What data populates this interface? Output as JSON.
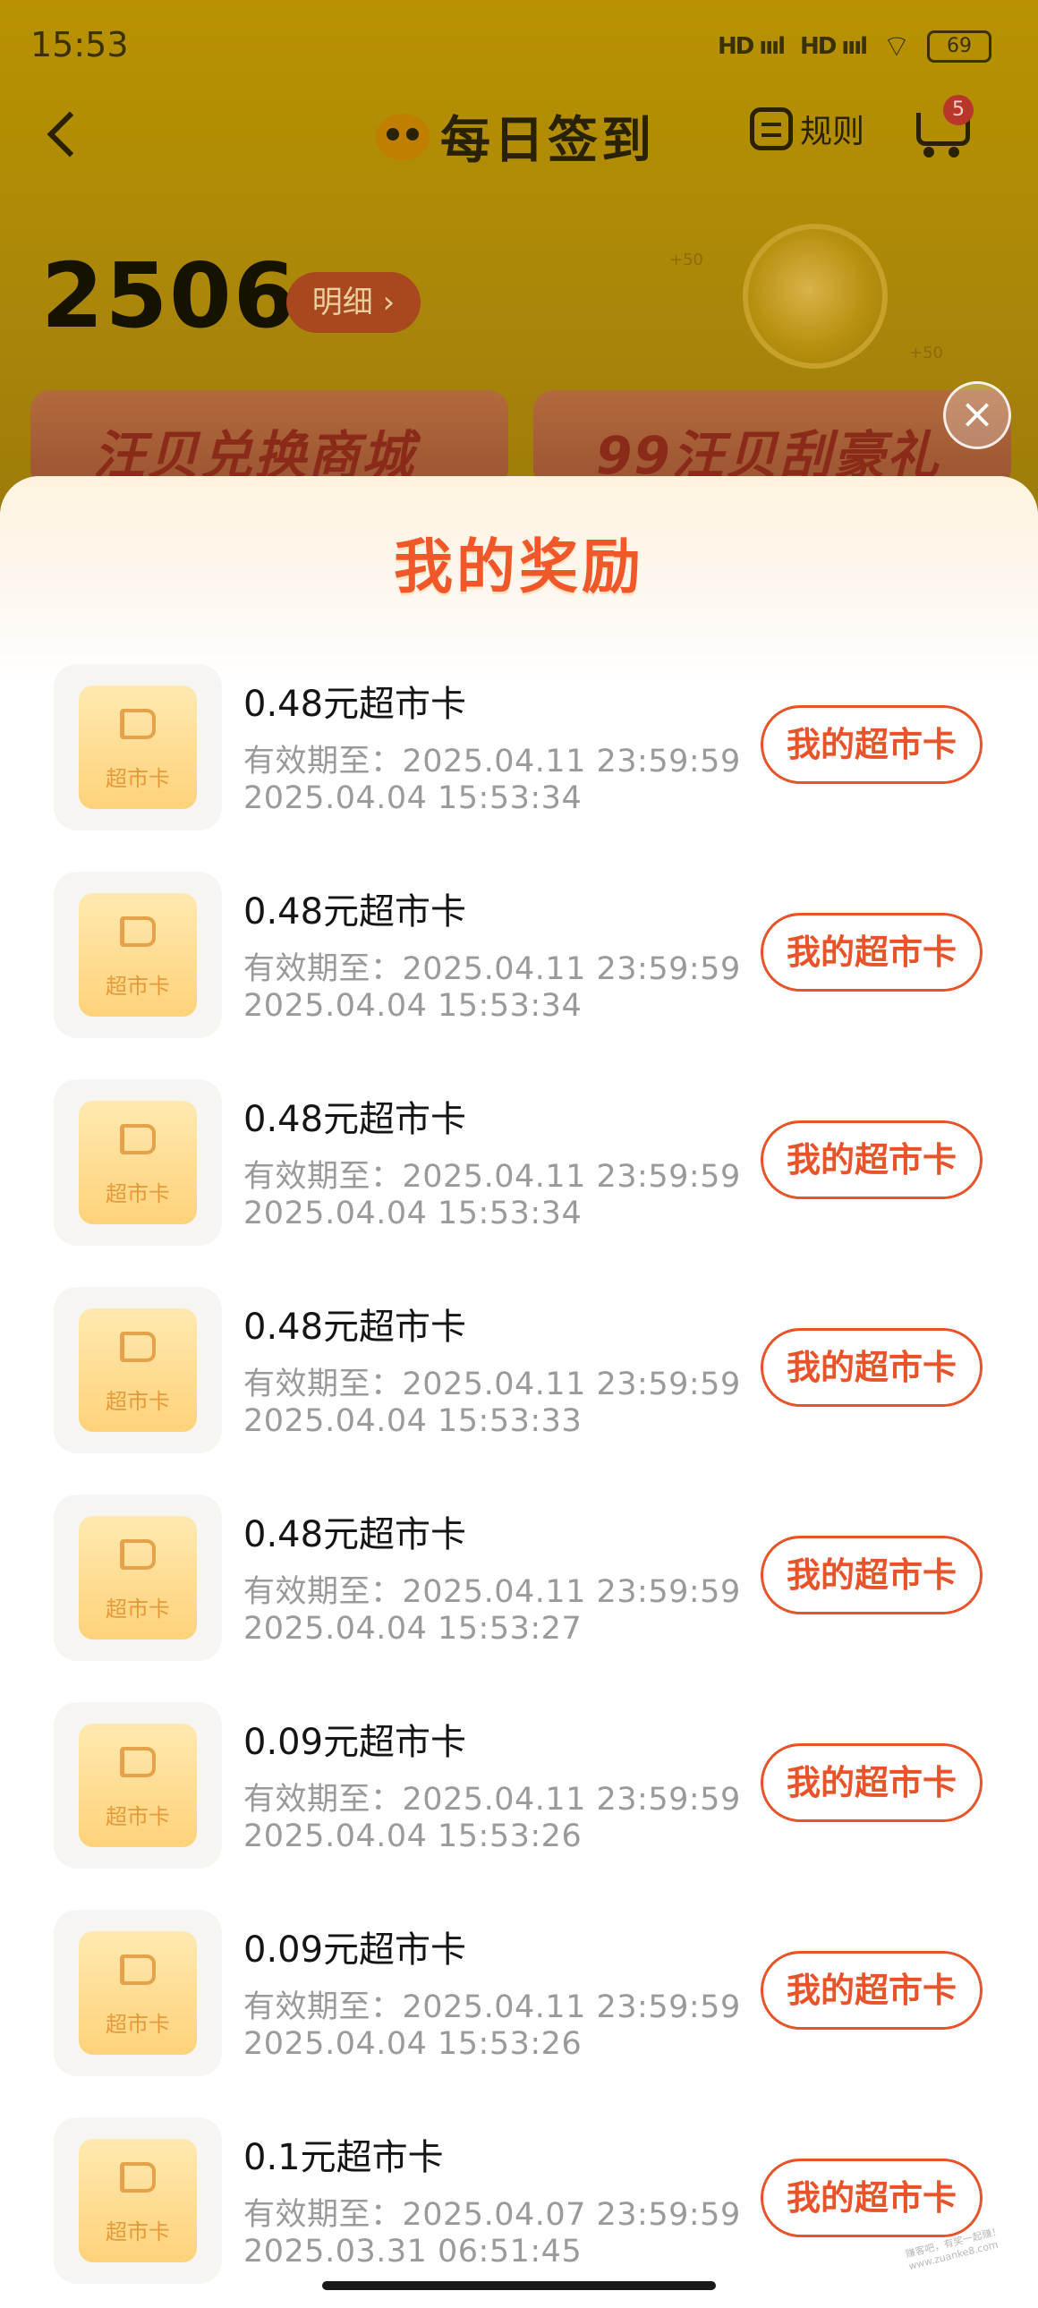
{
  "status_bar": {
    "time": "15:53",
    "signal1": "HD ıııl",
    "signal2": "HD ıııl",
    "battery": "69"
  },
  "header": {
    "title": "每日签到",
    "rules_label": "规则",
    "cart_badge": "5"
  },
  "summary": {
    "points": "2506",
    "detail_label": "明细 ›",
    "coin_bonus_a": "+50",
    "coin_bonus_b": "+50"
  },
  "banners": [
    {
      "text": "汪贝兑换商城"
    },
    {
      "text": "99汪贝刮豪礼"
    }
  ],
  "close_label": "×",
  "sheet": {
    "title": "我的奖励",
    "thumb_label": "超市卡",
    "items": [
      {
        "title": "0.48元超市卡",
        "expiry": "有效期至：2025.04.11 23:59:59",
        "time": "2025.04.04 15:53:34",
        "button": "我的超市卡"
      },
      {
        "title": "0.48元超市卡",
        "expiry": "有效期至：2025.04.11 23:59:59",
        "time": "2025.04.04 15:53:34",
        "button": "我的超市卡"
      },
      {
        "title": "0.48元超市卡",
        "expiry": "有效期至：2025.04.11 23:59:59",
        "time": "2025.04.04 15:53:34",
        "button": "我的超市卡"
      },
      {
        "title": "0.48元超市卡",
        "expiry": "有效期至：2025.04.11 23:59:59",
        "time": "2025.04.04 15:53:33",
        "button": "我的超市卡"
      },
      {
        "title": "0.48元超市卡",
        "expiry": "有效期至：2025.04.11 23:59:59",
        "time": "2025.04.04 15:53:27",
        "button": "我的超市卡"
      },
      {
        "title": "0.09元超市卡",
        "expiry": "有效期至：2025.04.11 23:59:59",
        "time": "2025.04.04 15:53:26",
        "button": "我的超市卡"
      },
      {
        "title": "0.09元超市卡",
        "expiry": "有效期至：2025.04.11 23:59:59",
        "time": "2025.04.04 15:53:26",
        "button": "我的超市卡"
      },
      {
        "title": "0.1元超市卡",
        "expiry": "有效期至：2025.04.07 23:59:59",
        "time": "2025.03.31 06:51:45",
        "button": "我的超市卡"
      }
    ]
  },
  "watermark": "赚客吧，有奖一起赚！ www.zuanke8.com"
}
